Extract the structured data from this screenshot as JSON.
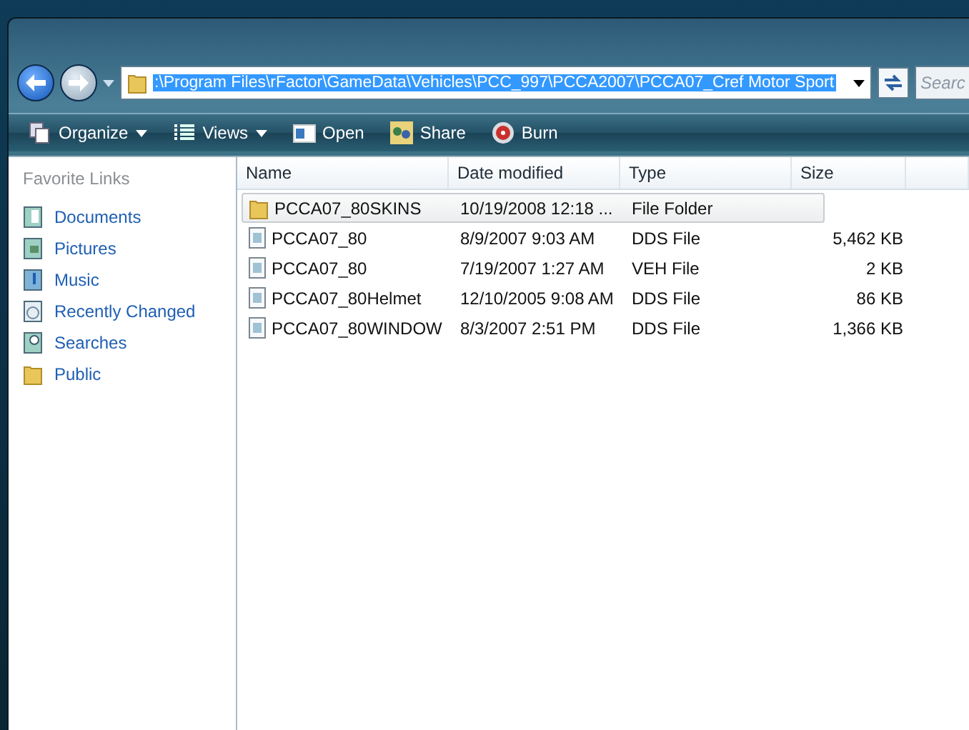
{
  "address_bar": {
    "path": ":\\Program Files\\rFactor\\GameData\\Vehicles\\PCC_997\\PCCA2007\\PCCA07_Cref Motor Sport",
    "search_placeholder": "Searc"
  },
  "toolbar": [
    {
      "label": "Organize",
      "kind": "organize",
      "dropdown": true
    },
    {
      "label": "Views",
      "kind": "views",
      "dropdown": true
    },
    {
      "label": "Open",
      "kind": "open",
      "dropdown": false
    },
    {
      "label": "Share",
      "kind": "share",
      "dropdown": false
    },
    {
      "label": "Burn",
      "kind": "burn",
      "dropdown": false
    }
  ],
  "sidebar": {
    "title": "Favorite Links",
    "items": [
      {
        "label": "Documents",
        "kind": "documents"
      },
      {
        "label": "Pictures",
        "kind": "pictures"
      },
      {
        "label": "Music",
        "kind": "music"
      },
      {
        "label": "Recently Changed",
        "kind": "recent"
      },
      {
        "label": "Searches",
        "kind": "searches"
      },
      {
        "label": "Public",
        "kind": "folder"
      }
    ]
  },
  "table": {
    "columns": [
      "Name",
      "Date modified",
      "Type",
      "Size"
    ],
    "rows": [
      {
        "name": "PCCA07_80SKINS",
        "date": "10/19/2008 12:18 ...",
        "type": "File Folder",
        "size": "",
        "kind": "folder",
        "selected": true
      },
      {
        "name": "PCCA07_80",
        "date": "8/9/2007 9:03 AM",
        "type": "DDS File",
        "size": "5,462 KB",
        "kind": "file",
        "selected": false
      },
      {
        "name": "PCCA07_80",
        "date": "7/19/2007 1:27 AM",
        "type": "VEH File",
        "size": "2 KB",
        "kind": "file",
        "selected": false
      },
      {
        "name": "PCCA07_80Helmet",
        "date": "12/10/2005 9:08 AM",
        "type": "DDS File",
        "size": "86 KB",
        "kind": "file",
        "selected": false
      },
      {
        "name": "PCCA07_80WINDOW",
        "date": "8/3/2007 2:51 PM",
        "type": "DDS File",
        "size": "1,366 KB",
        "kind": "file",
        "selected": false
      }
    ]
  }
}
